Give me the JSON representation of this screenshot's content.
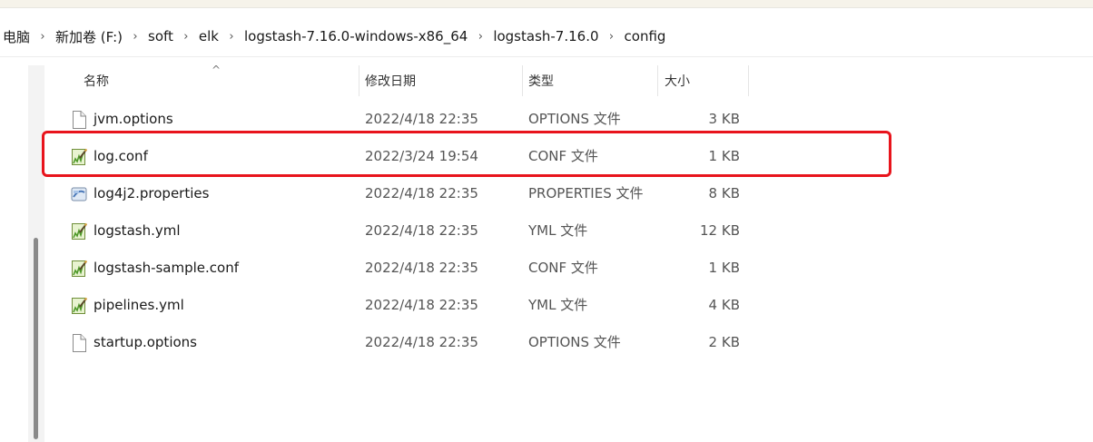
{
  "breadcrumb": {
    "items": [
      "电脑",
      "新加卷 (F:)",
      "soft",
      "elk",
      "logstash-7.16.0-windows-x86_64",
      "logstash-7.16.0",
      "config"
    ],
    "separator": "›"
  },
  "columns": {
    "name": "名称",
    "date": "修改日期",
    "type": "类型",
    "size": "大小",
    "sort_indicator": "^"
  },
  "files": [
    {
      "name": "jvm.options",
      "date": "2022/4/18 22:35",
      "type": "OPTIONS 文件",
      "size": "3 KB",
      "icon": "blank-file-icon"
    },
    {
      "name": "log.conf",
      "date": "2022/3/24 19:54",
      "type": "CONF 文件",
      "size": "1 KB",
      "icon": "notepadpp-file-icon"
    },
    {
      "name": "log4j2.properties",
      "date": "2022/4/18 22:35",
      "type": "PROPERTIES 文件",
      "size": "8 KB",
      "icon": "properties-file-icon"
    },
    {
      "name": "logstash.yml",
      "date": "2022/4/18 22:35",
      "type": "YML 文件",
      "size": "12 KB",
      "icon": "notepadpp-file-icon"
    },
    {
      "name": "logstash-sample.conf",
      "date": "2022/4/18 22:35",
      "type": "CONF 文件",
      "size": "1 KB",
      "icon": "notepadpp-file-icon"
    },
    {
      "name": "pipelines.yml",
      "date": "2022/4/18 22:35",
      "type": "YML 文件",
      "size": "4 KB",
      "icon": "notepadpp-file-icon"
    },
    {
      "name": "startup.options",
      "date": "2022/4/18 22:35",
      "type": "OPTIONS 文件",
      "size": "2 KB",
      "icon": "blank-file-icon"
    }
  ],
  "colors": {
    "highlight_border": "#e8141c",
    "scrollbar_thumb": "#8a8a8a"
  }
}
